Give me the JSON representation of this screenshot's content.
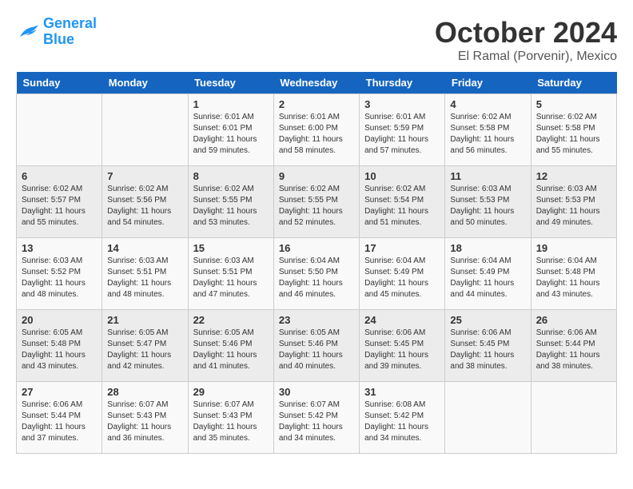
{
  "logo": {
    "line1": "General",
    "line2": "Blue"
  },
  "title": "October 2024",
  "location": "El Ramal (Porvenir), Mexico",
  "weekdays": [
    "Sunday",
    "Monday",
    "Tuesday",
    "Wednesday",
    "Thursday",
    "Friday",
    "Saturday"
  ],
  "weeks": [
    [
      {
        "day": "",
        "info": ""
      },
      {
        "day": "",
        "info": ""
      },
      {
        "day": "1",
        "info": "Sunrise: 6:01 AM\nSunset: 6:01 PM\nDaylight: 11 hours and 59 minutes."
      },
      {
        "day": "2",
        "info": "Sunrise: 6:01 AM\nSunset: 6:00 PM\nDaylight: 11 hours and 58 minutes."
      },
      {
        "day": "3",
        "info": "Sunrise: 6:01 AM\nSunset: 5:59 PM\nDaylight: 11 hours and 57 minutes."
      },
      {
        "day": "4",
        "info": "Sunrise: 6:02 AM\nSunset: 5:58 PM\nDaylight: 11 hours and 56 minutes."
      },
      {
        "day": "5",
        "info": "Sunrise: 6:02 AM\nSunset: 5:58 PM\nDaylight: 11 hours and 55 minutes."
      }
    ],
    [
      {
        "day": "6",
        "info": "Sunrise: 6:02 AM\nSunset: 5:57 PM\nDaylight: 11 hours and 55 minutes."
      },
      {
        "day": "7",
        "info": "Sunrise: 6:02 AM\nSunset: 5:56 PM\nDaylight: 11 hours and 54 minutes."
      },
      {
        "day": "8",
        "info": "Sunrise: 6:02 AM\nSunset: 5:55 PM\nDaylight: 11 hours and 53 minutes."
      },
      {
        "day": "9",
        "info": "Sunrise: 6:02 AM\nSunset: 5:55 PM\nDaylight: 11 hours and 52 minutes."
      },
      {
        "day": "10",
        "info": "Sunrise: 6:02 AM\nSunset: 5:54 PM\nDaylight: 11 hours and 51 minutes."
      },
      {
        "day": "11",
        "info": "Sunrise: 6:03 AM\nSunset: 5:53 PM\nDaylight: 11 hours and 50 minutes."
      },
      {
        "day": "12",
        "info": "Sunrise: 6:03 AM\nSunset: 5:53 PM\nDaylight: 11 hours and 49 minutes."
      }
    ],
    [
      {
        "day": "13",
        "info": "Sunrise: 6:03 AM\nSunset: 5:52 PM\nDaylight: 11 hours and 48 minutes."
      },
      {
        "day": "14",
        "info": "Sunrise: 6:03 AM\nSunset: 5:51 PM\nDaylight: 11 hours and 48 minutes."
      },
      {
        "day": "15",
        "info": "Sunrise: 6:03 AM\nSunset: 5:51 PM\nDaylight: 11 hours and 47 minutes."
      },
      {
        "day": "16",
        "info": "Sunrise: 6:04 AM\nSunset: 5:50 PM\nDaylight: 11 hours and 46 minutes."
      },
      {
        "day": "17",
        "info": "Sunrise: 6:04 AM\nSunset: 5:49 PM\nDaylight: 11 hours and 45 minutes."
      },
      {
        "day": "18",
        "info": "Sunrise: 6:04 AM\nSunset: 5:49 PM\nDaylight: 11 hours and 44 minutes."
      },
      {
        "day": "19",
        "info": "Sunrise: 6:04 AM\nSunset: 5:48 PM\nDaylight: 11 hours and 43 minutes."
      }
    ],
    [
      {
        "day": "20",
        "info": "Sunrise: 6:05 AM\nSunset: 5:48 PM\nDaylight: 11 hours and 43 minutes."
      },
      {
        "day": "21",
        "info": "Sunrise: 6:05 AM\nSunset: 5:47 PM\nDaylight: 11 hours and 42 minutes."
      },
      {
        "day": "22",
        "info": "Sunrise: 6:05 AM\nSunset: 5:46 PM\nDaylight: 11 hours and 41 minutes."
      },
      {
        "day": "23",
        "info": "Sunrise: 6:05 AM\nSunset: 5:46 PM\nDaylight: 11 hours and 40 minutes."
      },
      {
        "day": "24",
        "info": "Sunrise: 6:06 AM\nSunset: 5:45 PM\nDaylight: 11 hours and 39 minutes."
      },
      {
        "day": "25",
        "info": "Sunrise: 6:06 AM\nSunset: 5:45 PM\nDaylight: 11 hours and 38 minutes."
      },
      {
        "day": "26",
        "info": "Sunrise: 6:06 AM\nSunset: 5:44 PM\nDaylight: 11 hours and 38 minutes."
      }
    ],
    [
      {
        "day": "27",
        "info": "Sunrise: 6:06 AM\nSunset: 5:44 PM\nDaylight: 11 hours and 37 minutes."
      },
      {
        "day": "28",
        "info": "Sunrise: 6:07 AM\nSunset: 5:43 PM\nDaylight: 11 hours and 36 minutes."
      },
      {
        "day": "29",
        "info": "Sunrise: 6:07 AM\nSunset: 5:43 PM\nDaylight: 11 hours and 35 minutes."
      },
      {
        "day": "30",
        "info": "Sunrise: 6:07 AM\nSunset: 5:42 PM\nDaylight: 11 hours and 34 minutes."
      },
      {
        "day": "31",
        "info": "Sunrise: 6:08 AM\nSunset: 5:42 PM\nDaylight: 11 hours and 34 minutes."
      },
      {
        "day": "",
        "info": ""
      },
      {
        "day": "",
        "info": ""
      }
    ]
  ]
}
